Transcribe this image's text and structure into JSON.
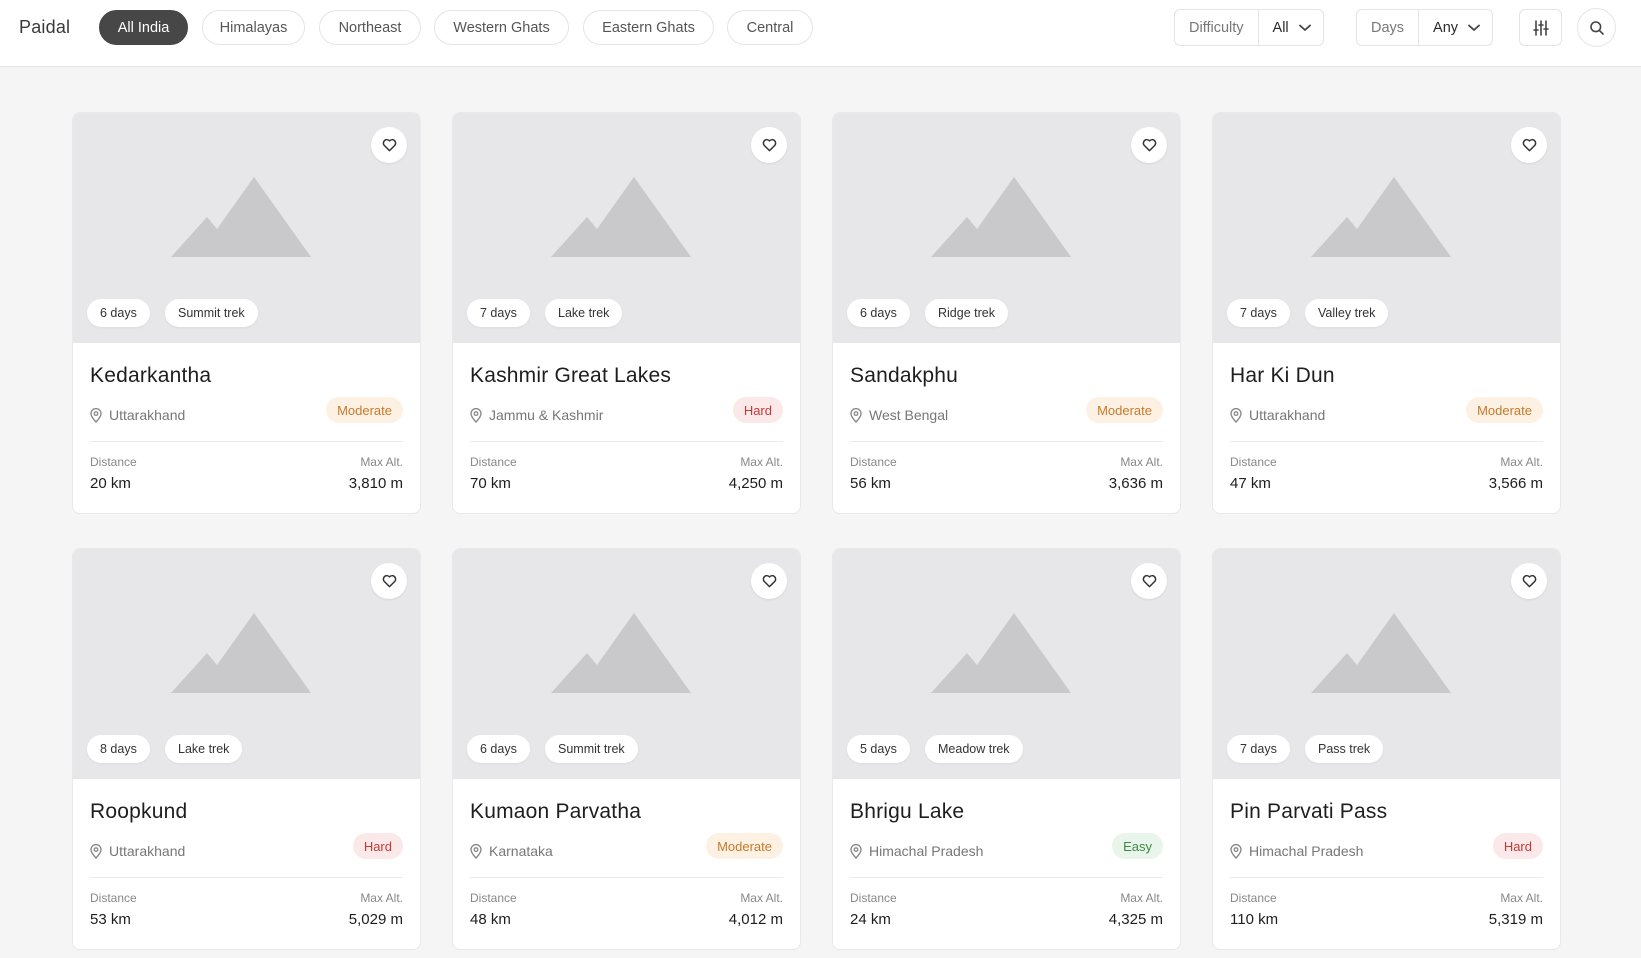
{
  "brand": "Paidal",
  "regions": [
    "All India",
    "Himalayas",
    "Northeast",
    "Western Ghats",
    "Eastern Ghats",
    "Central"
  ],
  "active_region": "All India",
  "filters": {
    "difficulty": {
      "label": "Difficulty",
      "value": "All"
    },
    "days": {
      "label": "Days",
      "value": "Any"
    }
  },
  "icons": {
    "filter": "sliders-icon",
    "search": "search-icon",
    "chevron": "chevron-down-icon",
    "favorite": "heart-icon",
    "location": "map-pin-icon",
    "placeholder": "mountain-icon"
  },
  "colors": {
    "active_chip": "#474747",
    "moderate": "#c77a2a",
    "hard": "#c23a3a",
    "easy": "#3d8a47"
  },
  "labels": {
    "distance": "Distance",
    "max_alt": "Max Alt."
  },
  "treks": [
    {
      "name": "Kedarkantha",
      "location": "Uttarakhand",
      "difficulty": "Moderate",
      "days": "6 days",
      "type": "Summit trek",
      "distance": "20 km",
      "altitude": "3,810 m"
    },
    {
      "name": "Kashmir Great Lakes",
      "location": "Jammu & Kashmir",
      "difficulty": "Hard",
      "days": "7 days",
      "type": "Lake trek",
      "distance": "70 km",
      "altitude": "4,250 m"
    },
    {
      "name": "Sandakphu",
      "location": "West Bengal",
      "difficulty": "Moderate",
      "days": "6 days",
      "type": "Ridge trek",
      "distance": "56 km",
      "altitude": "3,636 m"
    },
    {
      "name": "Har Ki Dun",
      "location": "Uttarakhand",
      "difficulty": "Moderate",
      "days": "7 days",
      "type": "Valley trek",
      "distance": "47 km",
      "altitude": "3,566 m"
    },
    {
      "name": "Roopkund",
      "location": "Uttarakhand",
      "difficulty": "Hard",
      "days": "8 days",
      "type": "Lake trek",
      "distance": "53 km",
      "altitude": "5,029 m"
    },
    {
      "name": "Kumaon Parvatha",
      "location": "Karnataka",
      "difficulty": "Moderate",
      "days": "6 days",
      "type": "Summit trek",
      "distance": "48 km",
      "altitude": "4,012 m"
    },
    {
      "name": "Bhrigu Lake",
      "location": "Himachal Pradesh",
      "difficulty": "Easy",
      "days": "5 days",
      "type": "Meadow trek",
      "distance": "24 km",
      "altitude": "4,325 m"
    },
    {
      "name": "Pin Parvati Pass",
      "location": "Himachal Pradesh",
      "difficulty": "Hard",
      "days": "7 days",
      "type": "Pass trek",
      "distance": "110 km",
      "altitude": "5,319 m"
    }
  ]
}
